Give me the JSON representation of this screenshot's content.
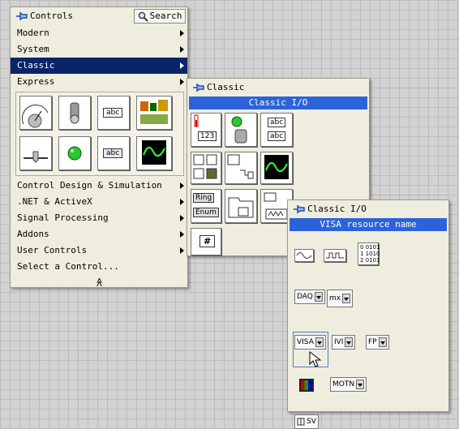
{
  "controls_palette": {
    "title": "Controls",
    "search_label": "Search",
    "menu": [
      {
        "label": "Modern",
        "has_submenu": true
      },
      {
        "label": "System",
        "has_submenu": true
      },
      {
        "label": "Classic",
        "has_submenu": true,
        "selected": true
      },
      {
        "label": "Express",
        "has_submenu": true
      }
    ],
    "menu_lower": [
      {
        "label": "Control Design & Simulation",
        "has_submenu": true
      },
      {
        "label": ".NET & ActiveX",
        "has_submenu": true
      },
      {
        "label": "Signal Processing",
        "has_submenu": true
      },
      {
        "label": "Addons",
        "has_submenu": true
      },
      {
        "label": "User Controls",
        "has_submenu": true
      },
      {
        "label": "Select a Control...",
        "has_submenu": false
      }
    ],
    "express_icons": [
      {
        "name": "knob-gauge",
        "glyph": ""
      },
      {
        "name": "toggle-switch",
        "glyph": ""
      },
      {
        "name": "string-control",
        "glyph": "abc"
      },
      {
        "name": "express-array-cluster",
        "glyph": ""
      },
      {
        "name": "slider",
        "glyph": ""
      },
      {
        "name": "led",
        "glyph": ""
      },
      {
        "name": "string-indicator",
        "glyph": "abc"
      },
      {
        "name": "graph-indicator",
        "glyph": ""
      }
    ],
    "collapse_glyph": "≪"
  },
  "classic_palette": {
    "title": "Classic",
    "header": "Classic I/O",
    "icons": {
      "numeric_value": "123",
      "string_a": "abc",
      "string_b": "abc",
      "ring": "Ring",
      "enum": "Enum",
      "refnum": "#"
    }
  },
  "classic_io_palette": {
    "title": "Classic I/O",
    "header": "VISA resource name",
    "items": {
      "daq": "DAQ",
      "mx": "mx",
      "visa": "VISA",
      "ivi": "IVI",
      "fp": "FP",
      "motn": "MOTN",
      "sv": "SV",
      "binary": "0 0101\n1 1010\n2 0101"
    }
  },
  "colors": {
    "selected": "#0a246a",
    "header_blue": "#2c63d9",
    "palette_bg": "#efedde"
  }
}
